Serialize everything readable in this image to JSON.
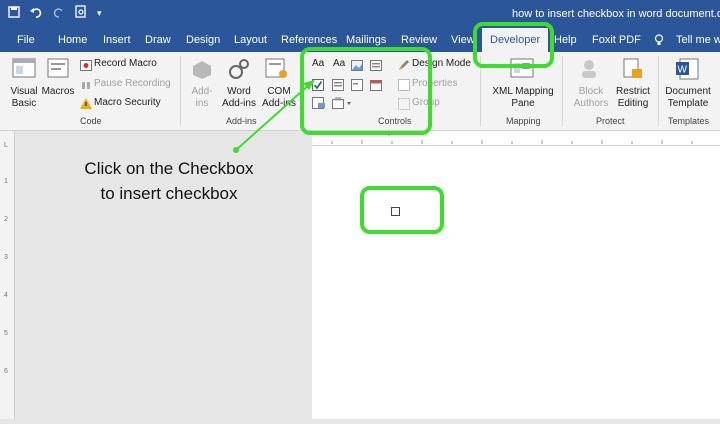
{
  "window": {
    "title": "how to insert checkbox in word document.docx"
  },
  "tabs": [
    {
      "label": "File"
    },
    {
      "label": "Home"
    },
    {
      "label": "Insert"
    },
    {
      "label": "Draw"
    },
    {
      "label": "Design"
    },
    {
      "label": "Layout"
    },
    {
      "label": "References"
    },
    {
      "label": "Mailings"
    },
    {
      "label": "Review"
    },
    {
      "label": "View"
    },
    {
      "label": "Developer"
    },
    {
      "label": "Help"
    },
    {
      "label": "Foxit PDF"
    },
    {
      "label": "Tell me wh"
    }
  ],
  "ribbon": {
    "code": {
      "label": "Code",
      "visual_basic": "Visual Basic",
      "macros": "Macros",
      "record_macro": "Record Macro",
      "pause_recording": "Pause Recording",
      "macro_security": "Macro Security"
    },
    "addins": {
      "label": "Add-ins",
      "add_ins": "Add-ins",
      "word_add_ins": "Word Add-ins",
      "com_add_ins": "COM Add-ins"
    },
    "controls": {
      "label": "Controls",
      "design_mode": "Design Mode",
      "properties": "Properties",
      "group": "Group"
    },
    "mapping": {
      "label": "Mapping",
      "xml_mapping_pane": "XML Mapping Pane"
    },
    "protect": {
      "label": "Protect",
      "block_authors": "Block Authors",
      "restrict_editing": "Restrict Editing"
    },
    "templates": {
      "label": "Templates",
      "document_template": "Document Template"
    }
  },
  "annotation": {
    "line1": "Click on the Checkbox",
    "line2": "to insert checkbox"
  },
  "colors": {
    "brand": "#2b579a",
    "highlight": "#3ddc2d",
    "ribbon": "#f3f3f3"
  }
}
